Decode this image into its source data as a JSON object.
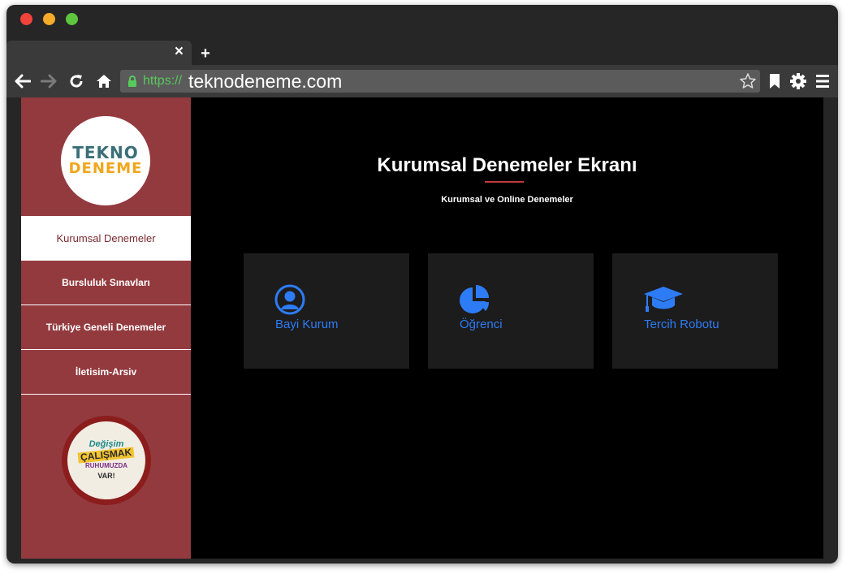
{
  "browser": {
    "tab_close": "×",
    "tab_new": "+",
    "url_protocol": "https://",
    "url_host": "teknodeneme.com"
  },
  "sidebar": {
    "logo": {
      "line1": "TEKNO",
      "line2": "DENEME"
    },
    "items": [
      {
        "label": "Kurumsal Denemeler",
        "active": true
      },
      {
        "label": "Bursluluk Sınavları",
        "active": false
      },
      {
        "label": "Türkiye Geneli Denemeler",
        "active": false
      },
      {
        "label": "İletisim-Arsiv",
        "active": false
      }
    ],
    "badge": {
      "line1": "Değişim",
      "line2": "ÇALIŞMAK",
      "line3": "RUHUMUZDA",
      "line4": "VAR!"
    }
  },
  "main": {
    "title": "Kurumsal Denemeler Ekranı",
    "subtitle": "Kurumsal ve Online Denemeler",
    "cards": [
      {
        "label": "Bayi Kurum",
        "icon": "user-circle-icon"
      },
      {
        "label": "Öğrenci",
        "icon": "pie-chart-icon"
      },
      {
        "label": "Tercih Robotu",
        "icon": "graduation-cap-icon"
      }
    ]
  },
  "colors": {
    "sidebar": "#933a3f",
    "accent": "#2d7cf6",
    "card": "#1c1c1c",
    "title_rule": "#c0393b"
  }
}
